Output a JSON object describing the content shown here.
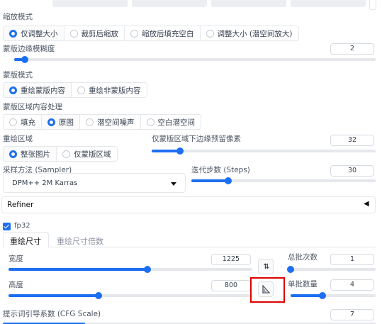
{
  "top_tabs": [
    "",
    "",
    "",
    "",
    ""
  ],
  "resize_mode": {
    "label": "缩放模式",
    "options": [
      "仅调整大小",
      "裁剪后缩放",
      "缩放后填充空白",
      "调整大小 (潜空间放大)"
    ],
    "selected": 0
  },
  "mask_blur": {
    "label": "蒙版边缘模糊度",
    "value": "2",
    "fraction": 0.03
  },
  "mask_mode": {
    "label": "蒙版模式",
    "options": [
      "重绘蒙版内容",
      "重绘非蒙版内容"
    ],
    "selected": 0
  },
  "masked_content": {
    "label": "蒙版区域内容处理",
    "options": [
      "填充",
      "原图",
      "潜空间噪声",
      "空白潜空间"
    ],
    "selected": 1
  },
  "inpaint_area": {
    "label": "重绘区域",
    "options": [
      "整张图片",
      "仅蒙版区域"
    ],
    "selected": 0
  },
  "only_masked_padding": {
    "label": "仅蒙版区域下边缘预留像素",
    "value": "32",
    "fraction": 0.125
  },
  "sampler": {
    "label": "采样方法 (Sampler)",
    "value": "DPM++ 2M Karras"
  },
  "steps": {
    "label": "迭代步数 (Steps)",
    "value": "30",
    "fraction": 0.2
  },
  "refiner": {
    "label": "Refiner",
    "arrow": "◀"
  },
  "fp32": {
    "label": "fp32",
    "checked": true
  },
  "size_tabs": [
    "重绘尺寸",
    "重绘尺寸倍数"
  ],
  "width": {
    "label": "宽度",
    "value": "1225",
    "fraction": 0.57
  },
  "height": {
    "label": "高度",
    "value": "800",
    "fraction": 0.37
  },
  "batch_count": {
    "label": "总批次数",
    "value": "1",
    "fraction": 0.0
  },
  "batch_size": {
    "label": "单批数量",
    "value": "4",
    "fraction": 0.375
  },
  "cfg_scale": {
    "label": "提示词引导系数 (CFG Scale)",
    "value": "7"
  },
  "icons": {
    "swap": "swap-vertical-icon",
    "ratio": "triangle-ruler-icon",
    "dropdown": "caret-down-icon"
  },
  "colors": {
    "accent": "#1d6ff2",
    "highlight_box": "#e00000"
  }
}
